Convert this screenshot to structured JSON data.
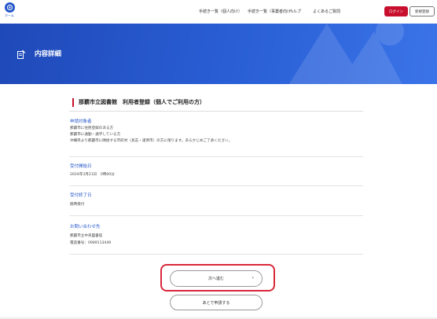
{
  "header": {
    "home_label": "ホーム",
    "nav": [
      {
        "label": "手続き一覧（個人向け）"
      },
      {
        "label": "手続き一覧（事業者向け）"
      },
      {
        "label": "ヘルプ"
      },
      {
        "label": "よくあるご質問"
      }
    ],
    "login_label": "ログイン",
    "register_label": "新規登録"
  },
  "banner": {
    "title": "内容詳細"
  },
  "page": {
    "heading": "那覇市立図書館　利用者登録（個人でご利用の方）",
    "sections": [
      {
        "label": "申請対象者",
        "lines": [
          "那覇市に住民登録のある方",
          "那覇市に通勤・通学している方",
          "沖縄県より那覇市に隣接する市町村（具志・浦添市）の方に限ります。あらかじめご了承ください。"
        ]
      },
      {
        "label": "受付開始日",
        "lines": [
          "2024年3月21日　0時00分"
        ]
      },
      {
        "label": "受付終了日",
        "lines": [
          "随時受付"
        ]
      },
      {
        "label": "お問い合わせ先",
        "lines": [
          "那覇市立中央図書館",
          "電話番号：0989113449"
        ]
      }
    ]
  },
  "actions": {
    "next_label": "次へ進む",
    "later_label": "あとで申請する"
  },
  "colors": {
    "brand_blue": "#2356c9",
    "accent_red": "#c8102e"
  }
}
